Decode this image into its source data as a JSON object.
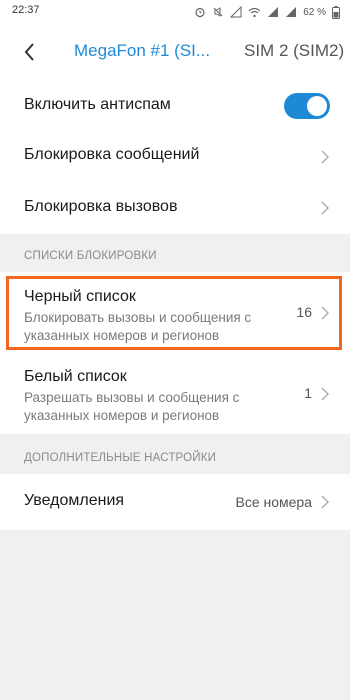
{
  "status_bar": {
    "time": "22:37",
    "battery": "62 %"
  },
  "toolbar": {
    "tab_sim1": "MegaFon #1 (SI...",
    "tab_sim2": "SIM 2 (SIM2)"
  },
  "settings": {
    "antispam_label": "Включить антиспам",
    "antispam_enabled": true,
    "block_messages_label": "Блокировка сообщений",
    "block_calls_label": "Блокировка вызовов"
  },
  "block_lists": {
    "header": "СПИСКИ БЛОКИРОВКИ",
    "blacklist": {
      "label": "Черный список",
      "description": "Блокировать вызовы и сообщения с указанных номеров и регионов",
      "count": "16"
    },
    "whitelist": {
      "label": "Белый список",
      "description": "Разрешать вызовы и сообщения с указанных номеров и регионов",
      "count": "1"
    }
  },
  "additional": {
    "header": "ДОПОЛНИТЕЛЬНЫЕ НАСТРОЙКИ",
    "notifications_label": "Уведомления",
    "notifications_value": "Все номера"
  },
  "colors": {
    "accent": "#1e8ad6",
    "highlight": "#f26522",
    "background": "#f0f0f0"
  }
}
